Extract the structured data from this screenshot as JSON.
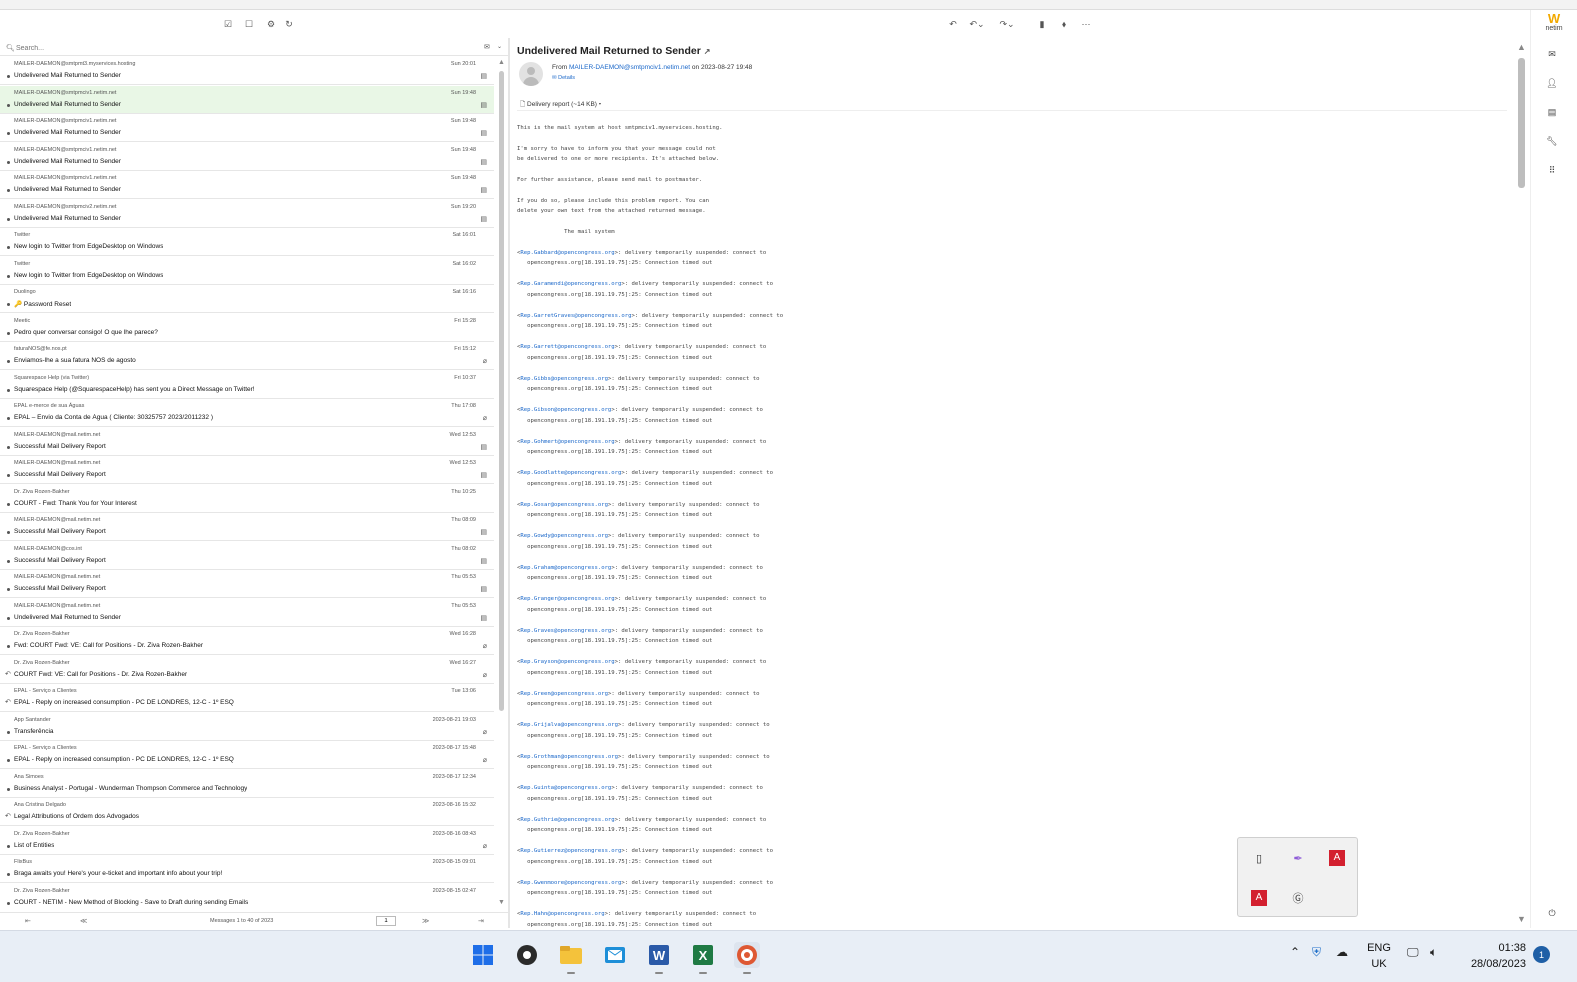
{
  "list_toolbar": {
    "icons": [
      "select-icon",
      "compose-icon",
      "settings-icon",
      "refresh-icon"
    ]
  },
  "message_toolbar": {
    "icons": [
      "reply-icon",
      "reply-all-icon",
      "forward-icon",
      "delete-icon",
      "tag-icon",
      "more-icon"
    ]
  },
  "search": {
    "placeholder": "Search..."
  },
  "messages": [
    {
      "from": "MAILER-DAEMON@smtpmt3.myservices.hosting",
      "date": "Sun 20:01",
      "subject": "Undelivered Mail Returned to Sender",
      "icon": "doc"
    },
    {
      "from": "MAILER-DAEMON@smtpmciv1.netim.net",
      "date": "Sun 19:48",
      "subject": "Undelivered Mail Returned to Sender",
      "icon": "doc",
      "selected": true
    },
    {
      "from": "MAILER-DAEMON@smtpmciv1.netim.net",
      "date": "Sun 19:48",
      "subject": "Undelivered Mail Returned to Sender",
      "icon": "doc"
    },
    {
      "from": "MAILER-DAEMON@smtpmciv1.netim.net",
      "date": "Sun 19:48",
      "subject": "Undelivered Mail Returned to Sender",
      "icon": "doc"
    },
    {
      "from": "MAILER-DAEMON@smtpmciv1.netim.net",
      "date": "Sun 19:48",
      "subject": "Undelivered Mail Returned to Sender",
      "icon": "doc"
    },
    {
      "from": "MAILER-DAEMON@smtpmciv2.netim.net",
      "date": "Sun 19:20",
      "subject": "Undelivered Mail Returned to Sender",
      "icon": "doc"
    },
    {
      "from": "Twitter",
      "date": "Sat 16:01",
      "subject": "New login to Twitter from EdgeDesktop on Windows",
      "icon": ""
    },
    {
      "from": "Twitter",
      "date": "Sat 16:02",
      "subject": "New login to Twitter from EdgeDesktop on Windows",
      "icon": ""
    },
    {
      "from": "Duolingo",
      "date": "Sat 16:16",
      "subject": "🔑 Password Reset",
      "icon": ""
    },
    {
      "from": "Meetic",
      "date": "Fri 15:28",
      "subject": "Pedro quer conversar consigo! O que lhe parece?",
      "icon": ""
    },
    {
      "from": "faturaNOS@fe.nos.pt",
      "date": "Fri 15:12",
      "subject": "Enviamos-lhe a sua fatura NOS de agosto",
      "icon": "clip"
    },
    {
      "from": "Squarespace Help (via Twitter)",
      "date": "Fri 10:37",
      "subject": "Squarespace Help (@SquarespaceHelp) has sent you a Direct Message on Twitter!",
      "icon": ""
    },
    {
      "from": "EPAL e-merce de sua Águas",
      "date": "Thu 17:08",
      "subject": "EPAL – Envio da Conta de Água ( Cliente: 30325757 2023/2011232 )",
      "icon": "clip"
    },
    {
      "from": "MAILER-DAEMON@mail.netim.net",
      "date": "Wed 12:53",
      "subject": "Successful Mail Delivery Report",
      "icon": "doc"
    },
    {
      "from": "MAILER-DAEMON@mail.netim.net",
      "date": "Wed 12:53",
      "subject": "Successful Mail Delivery Report",
      "icon": "doc"
    },
    {
      "from": "Dr. Ziva Rozen-Bakher",
      "date": "Thu 10:25",
      "subject": "COURT - Fwd: Thank You for Your Interest",
      "icon": ""
    },
    {
      "from": "MAILER-DAEMON@mail.netim.net",
      "date": "Thu 08:09",
      "subject": "Successful Mail Delivery Report",
      "icon": "doc"
    },
    {
      "from": "MAILER-DAEMON@cos.int",
      "date": "Thu 08:02",
      "subject": "Successful Mail Delivery Report",
      "icon": "doc"
    },
    {
      "from": "MAILER-DAEMON@mail.netim.net",
      "date": "Thu 05:53",
      "subject": "Successful Mail Delivery Report",
      "icon": "doc"
    },
    {
      "from": "MAILER-DAEMON@mail.netim.net",
      "date": "Thu 05:53",
      "subject": "Undelivered Mail Returned to Sender",
      "icon": "doc"
    },
    {
      "from": "Dr. Ziva Rozen-Bakher",
      "date": "Wed 16:28",
      "subject": "Fwd: COURT Fwd: VE: Call for Positions - Dr. Ziva Rozen-Bakher",
      "icon": "clip"
    },
    {
      "from": "Dr. Ziva Rozen-Bakher",
      "date": "Wed 16:27",
      "subject": "COURT Fwd: VE: Call for Positions - Dr. Ziva Rozen-Bakher",
      "icon": "clip",
      "replied": true
    },
    {
      "from": "EPAL - Serviço a Clientes",
      "date": "Tue 13:06",
      "subject": "EPAL - Reply on increased consumption - PC DE LONDRES, 12-C - 1º ESQ",
      "icon": "",
      "replied": true
    },
    {
      "from": "App Santander",
      "date": "2023-08-21 19:03",
      "subject": "Transferência",
      "icon": "clip"
    },
    {
      "from": "EPAL - Serviço a Clientes",
      "date": "2023-08-17 15:48",
      "subject": "EPAL - Reply on increased consumption - PC DE LONDRES, 12-C - 1º ESQ",
      "icon": "clip"
    },
    {
      "from": "Ana Simoes",
      "date": "2023-08-17 12:34",
      "subject": "Business Analyst - Portugal - Wunderman Thompson Commerce and Technology",
      "icon": ""
    },
    {
      "from": "Ana Cristina Delgado",
      "date": "2023-08-16 15:32",
      "subject": "Legal Attributions of Ordem dos Advogados",
      "icon": "",
      "replied": true
    },
    {
      "from": "Dr. Ziva Rozen-Bakher",
      "date": "2023-08-16 08:43",
      "subject": "List of Entities",
      "icon": "clip"
    },
    {
      "from": "FlixBus",
      "date": "2023-08-15 09:01",
      "subject": "Braga awaits you! Here's your e-ticket and important info about your trip!",
      "icon": ""
    },
    {
      "from": "Dr. Ziva Rozen-Bakher",
      "date": "2023-08-15 02:47",
      "subject": "COURT - NETIM - New Method of Blocking - Save to Draft during sending Emails",
      "icon": ""
    }
  ],
  "pager": {
    "info": "Messages 1 to 40 of 2023",
    "page": "1"
  },
  "reading": {
    "subject": "Undelivered Mail Returned to Sender",
    "from_label": "From",
    "from_address": "MAILER-DAEMON@smtpmciv1.netim.net",
    "on_label": "on",
    "date": "2023-08-27 19:48",
    "details": "Details",
    "attachment": "Delivery report (~14 KB)",
    "paragraphs": [
      "This is the mail system at host smtpmciv1.myservices.hosting.",
      "I'm sorry to have to inform you that your message could not\nbe delivered to one or more recipients. It's attached below.",
      "For further assistance, please send mail to postmaster.",
      "If you do so, please include this problem report. You can\ndelete your own text from the attached returned message.",
      "              The mail system"
    ],
    "error_suffix": ": delivery temporarily suspended: connect to",
    "error_line2": "   opencongress.org[18.191.19.75]:25: Connection timed out",
    "recipients": [
      "Rep.Gabbard@opencongress.org",
      "Rep.Garamendi@opencongress.org",
      "Rep.GarretGraves@opencongress.org",
      "Rep.Garrett@opencongress.org",
      "Rep.Gibbs@opencongress.org",
      "Rep.Gibson@opencongress.org",
      "Rep.Gohmert@opencongress.org",
      "Rep.Goodlatte@opencongress.org",
      "Rep.Gosar@opencongress.org",
      "Rep.Gowdy@opencongress.org",
      "Rep.Graham@opencongress.org",
      "Rep.Granger@opencongress.org",
      "Rep.Graves@opencongress.org",
      "Rep.Grayson@opencongress.org",
      "Rep.Green@opencongress.org",
      "Rep.Grijalva@opencongress.org",
      "Rep.Grothman@opencongress.org",
      "Rep.Guinta@opencongress.org",
      "Rep.Guthrie@opencongress.org",
      "Rep.Gutierrez@opencongress.org",
      "Rep.Gwenmoore@opencongress.org",
      "Rep.Hahn@opencongress.org"
    ]
  },
  "rail": {
    "brand": "netim",
    "icons": [
      "mail-icon",
      "contacts-icon",
      "calendar-icon",
      "settings-icon",
      "apps-icon",
      "power-icon"
    ]
  },
  "tray_popup": {
    "icons": [
      "usb-icon",
      "pen-icon",
      "adobe-icon",
      "adobe-icon",
      "grammarly-icon"
    ]
  },
  "taskbar": {
    "apps": [
      "windows-start-icon",
      "obs-icon",
      "file-explorer-icon",
      "outlook-icon",
      "word-icon",
      "excel-icon",
      "duckduckgo-icon"
    ],
    "lang_top": "ENG",
    "lang_bottom": "UK",
    "time": "01:38",
    "date": "28/08/2023",
    "notifications": "1"
  }
}
